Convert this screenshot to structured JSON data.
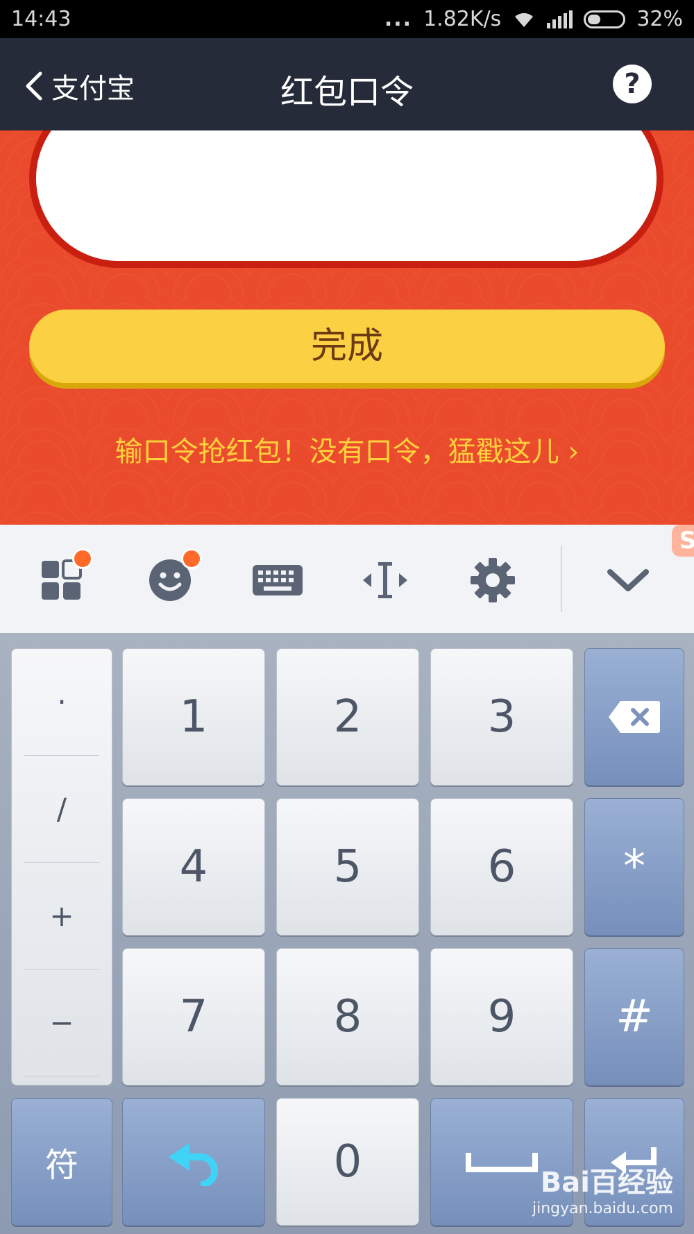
{
  "status_bar": {
    "time": "14:43",
    "dots": "...",
    "speed": "1.82K/s",
    "battery": "32%",
    "battery_level": 0.32
  },
  "nav": {
    "back_label": "支付宝",
    "title": "红包口令",
    "help_glyph": "?"
  },
  "form": {
    "input_value": "",
    "done_label": "完成",
    "hint_text": "输口令抢红包！没有口令，猛戳这儿 ›"
  },
  "toolbar": {
    "icons": [
      "apps-icon",
      "emoji-icon",
      "keyboard-icon",
      "cursor-icon",
      "settings-icon",
      "collapse-icon"
    ],
    "logo_glyph": "S"
  },
  "keyboard": {
    "symbols": [
      "·",
      "/",
      "+",
      "−"
    ],
    "row1": [
      "1",
      "2",
      "3"
    ],
    "row2": [
      "4",
      "5",
      "6"
    ],
    "row3": [
      "7",
      "8",
      "9"
    ],
    "right_col": [
      "⌫",
      "*",
      "#"
    ],
    "bottom": {
      "symbol_label": "符",
      "zero": "0"
    }
  },
  "watermark": {
    "line1": "Bai百经验",
    "line2": "jingyan.baidu.com"
  },
  "colors": {
    "nav": "#262b3a",
    "red": "#ea4b2c",
    "yellow": "#fbd042",
    "hint": "#ffd23c",
    "badge": "#ff6a2a"
  }
}
